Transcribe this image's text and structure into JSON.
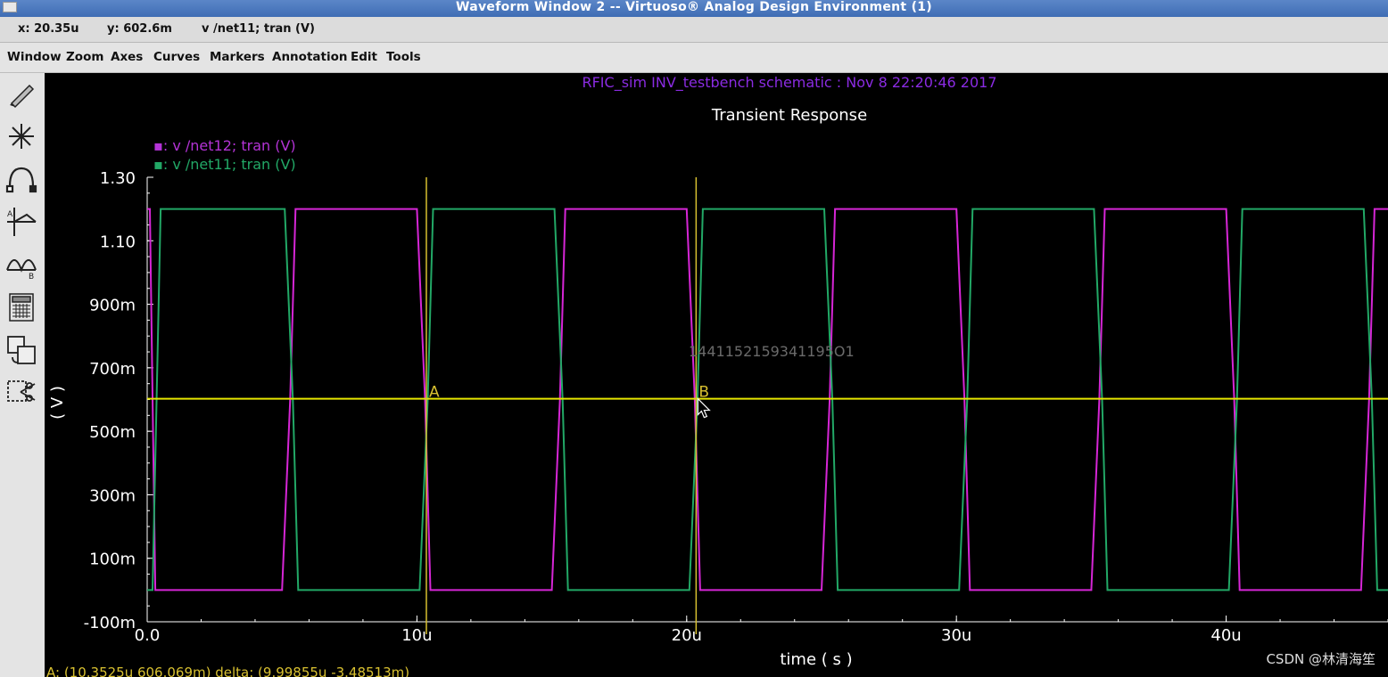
{
  "window": {
    "title": "Waveform Window 2 -- Virtuoso® Analog Design Environment (1)"
  },
  "status": {
    "x_readout": "x: 20.35u",
    "y_readout": "y: 602.6m",
    "signal_readout": "v /net11; tran (V)"
  },
  "menu": [
    "Window",
    "Zoom",
    "Axes",
    "Curves",
    "Markers",
    "Annotation",
    "Edit",
    "Tools"
  ],
  "toolbar": {
    "icons": [
      "pencil-icon",
      "snowflake-icon",
      "arc-icon",
      "crosshair-graph-icon",
      "waveform-ab-icon",
      "calculator-icon",
      "copy-window-icon",
      "scissors-icon"
    ]
  },
  "plot": {
    "header": "RFIC_sim INV_testbench schematic : Nov  8 22:20:46 2017",
    "overlay_text": "1441152159341195O1",
    "marker_readout": "A: (10.3525u 606.069m)      delta: (9.99855u -3.48513m)",
    "colors": {
      "background": "#000000",
      "net12": "#d626d6",
      "net11": "#22a866",
      "cursor_line": "#e6e600",
      "vertical_marker": "#d8c030",
      "header": "#8a2be2",
      "text": "#ffffff",
      "legend_net12": "#b433d6",
      "legend_net11": "#22a866"
    }
  },
  "chart_data": {
    "type": "line",
    "title": "Transient Response",
    "xlabel": "time ( s )",
    "ylabel": "( V )",
    "xlim": [
      0,
      46
    ],
    "ylim": [
      -0.1,
      1.3
    ],
    "x_unit": "us",
    "y_unit": "V",
    "grid": false,
    "legend_position": "top-left",
    "x_ticks": [
      {
        "value": 0,
        "label": "0.0"
      },
      {
        "value": 10,
        "label": "10u"
      },
      {
        "value": 20,
        "label": "20u"
      },
      {
        "value": 30,
        "label": "30u"
      },
      {
        "value": 40,
        "label": "40u"
      }
    ],
    "y_ticks": [
      {
        "value": 1.3,
        "label": "1.30"
      },
      {
        "value": 1.1,
        "label": "1.10"
      },
      {
        "value": 0.9,
        "label": "900m"
      },
      {
        "value": 0.7,
        "label": "700m"
      },
      {
        "value": 0.5,
        "label": "500m"
      },
      {
        "value": 0.3,
        "label": "300m"
      },
      {
        "value": 0.1,
        "label": "100m"
      },
      {
        "value": -0.1,
        "label": "-100m"
      }
    ],
    "series": [
      {
        "name": "v /net12; tran (V)",
        "legend": "▪: v /net12; tran (V)",
        "color": "#d626d6",
        "x": [
          0,
          0.1,
          0.3,
          5.0,
          5.3,
          5.5,
          10.0,
          10.3,
          10.5,
          15.0,
          15.3,
          15.5,
          20.0,
          20.3,
          20.5,
          25.0,
          25.3,
          25.5,
          30.0,
          30.3,
          30.5,
          35.0,
          35.3,
          35.5,
          40.0,
          40.3,
          40.5,
          45.0,
          45.3,
          45.5,
          46.0
        ],
        "values": [
          1.2,
          1.2,
          0.0,
          0.0,
          0.6,
          1.2,
          1.2,
          0.6,
          0.0,
          0.0,
          0.6,
          1.2,
          1.2,
          0.6,
          0.0,
          0.0,
          0.6,
          1.2,
          1.2,
          0.6,
          0.0,
          0.0,
          0.6,
          1.2,
          1.2,
          0.6,
          0.0,
          0.0,
          0.6,
          1.2,
          1.2
        ]
      },
      {
        "name": "v /net11; tran (V)",
        "legend": "▪: v /net11; tran (V)",
        "color": "#22a866",
        "x": [
          0,
          0.2,
          0.5,
          5.1,
          5.4,
          5.6,
          10.1,
          10.4,
          10.6,
          15.1,
          15.4,
          15.6,
          20.1,
          20.4,
          20.6,
          25.1,
          25.4,
          25.6,
          30.1,
          30.4,
          30.6,
          35.1,
          35.4,
          35.6,
          40.1,
          40.4,
          40.6,
          45.1,
          45.4,
          45.6,
          46.0
        ],
        "values": [
          0.0,
          0.0,
          1.2,
          1.2,
          0.6,
          0.0,
          0.0,
          0.6,
          1.2,
          1.2,
          0.6,
          0.0,
          0.0,
          0.6,
          1.2,
          1.2,
          0.6,
          0.0,
          0.0,
          0.6,
          1.2,
          1.2,
          0.6,
          0.0,
          0.0,
          0.6,
          1.2,
          1.2,
          0.6,
          0.0,
          0.0
        ]
      }
    ],
    "markers": [
      {
        "label": "A",
        "x": 10.35,
        "y": 0.606
      },
      {
        "label": "B",
        "x": 20.35,
        "y": 0.6026
      }
    ],
    "horizontal_cursor_y": 0.6026
  },
  "watermark": "CSDN @林清海笙"
}
